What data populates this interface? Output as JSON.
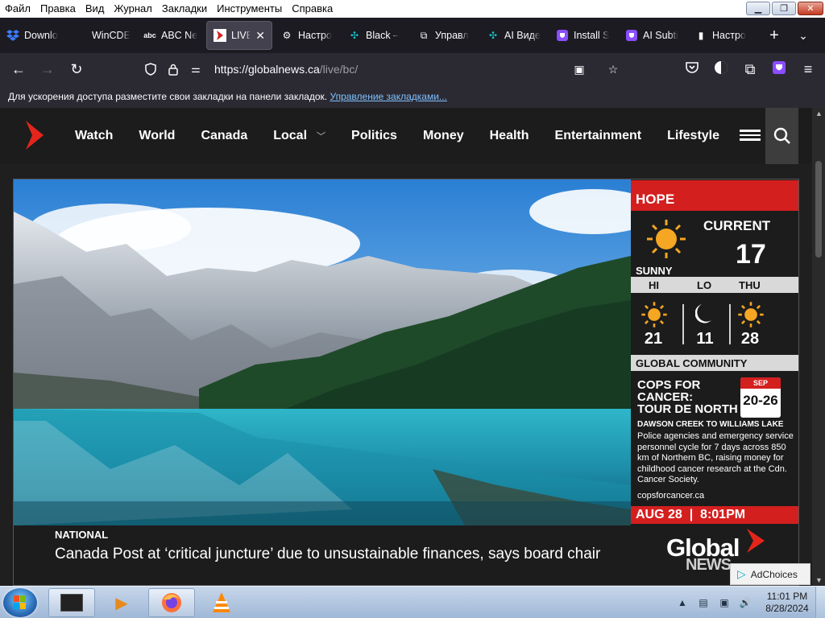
{
  "menubar": {
    "items": [
      "Файл",
      "Правка",
      "Вид",
      "Журнал",
      "Закладки",
      "Инструменты",
      "Справка"
    ]
  },
  "tabs": [
    {
      "label": "Downlo",
      "icon": "dropbox-icon",
      "active": false
    },
    {
      "label": "WinCDE",
      "icon": "",
      "active": false
    },
    {
      "label": "ABC Ne",
      "icon": "abc-icon",
      "active": false
    },
    {
      "label": "LIVE:",
      "icon": "global-news-icon",
      "active": true
    },
    {
      "label": "Настро",
      "icon": "gear-icon",
      "active": false
    },
    {
      "label": "Black –",
      "icon": "puzzle-teal-icon",
      "active": false
    },
    {
      "label": "Управл",
      "icon": "puzzle-icon",
      "active": false
    },
    {
      "label": "AI Виде",
      "icon": "puzzle-teal-icon",
      "active": false
    },
    {
      "label": "Install S",
      "icon": "shield-purple-icon",
      "active": false
    },
    {
      "label": "AI Subti",
      "icon": "shield-purple-icon",
      "active": false
    },
    {
      "label": "Настро",
      "icon": "bookmark-icon",
      "active": false
    }
  ],
  "url": {
    "host": "https://globalnews.ca",
    "path": "/live/bc/"
  },
  "bookmarks": {
    "text": "Для ускорения доступа разместите свои закладки на панели закладок.",
    "link": "Управление закладками..."
  },
  "site": {
    "nav": [
      "Watch",
      "World",
      "Canada",
      "Local",
      "Politics",
      "Money",
      "Health",
      "Entertainment",
      "Lifestyle"
    ]
  },
  "weather": {
    "location": "HOPE",
    "current_label": "CURRENT",
    "current_temp": "17",
    "condition": "SUNNY",
    "hi_label": "HI",
    "lo_label": "LO",
    "day_label": "THU",
    "hi": "21",
    "lo": "11",
    "day": "28"
  },
  "community": {
    "header": "GLOBAL COMMUNITY",
    "title_lines": [
      "COPS FOR",
      "CANCER:",
      "TOUR DE NORTH"
    ],
    "cal_month": "SEP",
    "cal_days": "20-26",
    "route": "DAWSON CREEK TO WILLIAMS LAKE",
    "description": "Police agencies and emergency service personnel cycle for 7 days across 850 km of Northern BC, raising money for childhood cancer research at the Cdn. Cancer Society.",
    "site": "copsforcancer.ca"
  },
  "broadcast": {
    "datetime": "AUG 28  |  8:01PM",
    "logo": "Global",
    "logo_sub": "NEWS"
  },
  "caption": {
    "tag": "NATIONAL",
    "title": "Canada Post at ‘critical juncture’ due to unsustainable finances, says board chair"
  },
  "adchoices": "AdChoices",
  "clock": {
    "time": "11:01 PM",
    "date": "8/28/2024"
  },
  "colors": {
    "accent_red": "#d41f1f",
    "browser_bg": "#1c1b22",
    "toolbar_bg": "#2b2a33"
  }
}
